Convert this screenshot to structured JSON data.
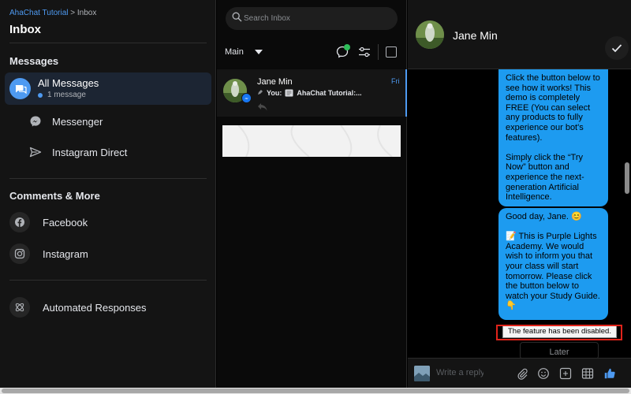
{
  "breadcrumb": {
    "parent": "AhaChat Tutorial",
    "separator": ">",
    "current": "Inbox"
  },
  "page_title": "Inbox",
  "sidebar": {
    "messages_heading": "Messages",
    "all_messages": {
      "label": "All Messages",
      "subtext": "1 message"
    },
    "messenger_label": "Messenger",
    "instagram_direct_label": "Instagram Direct",
    "comments_heading": "Comments & More",
    "facebook_label": "Facebook",
    "instagram_label": "Instagram",
    "automated_label": "Automated Responses"
  },
  "inbox": {
    "search_placeholder": "Search Inbox",
    "filter_value": "Main",
    "conversation": {
      "name": "Jane Min",
      "date": "Fri",
      "preview_prefix": "You:",
      "preview_text": "AhaChat Tutorial:..."
    }
  },
  "chat": {
    "contact_name": "Jane Min",
    "bubble1": [
      "Click the button below to see how it works! This demo is completely FREE (You can select any products to fully experience our bot's features).",
      "Simply click the “Try Now” button and experience the next-generation Artificial Intelligence."
    ],
    "bubble2": [
      "Good day, Jane. 😊",
      "📝 This is Purple Lights Academy. We would wish to inform you that your class will start tomorrow. Please click the button below to watch your Study Guide. 👇"
    ],
    "disabled_tooltip": "The feature has been disabled.",
    "later_label": "Later",
    "composer_placeholder": "Write a reply"
  },
  "colors": {
    "accent": "#4e9af1",
    "bubble": "#1d9bf0",
    "highlight": "#e0241b",
    "online": "#2ebd59"
  }
}
